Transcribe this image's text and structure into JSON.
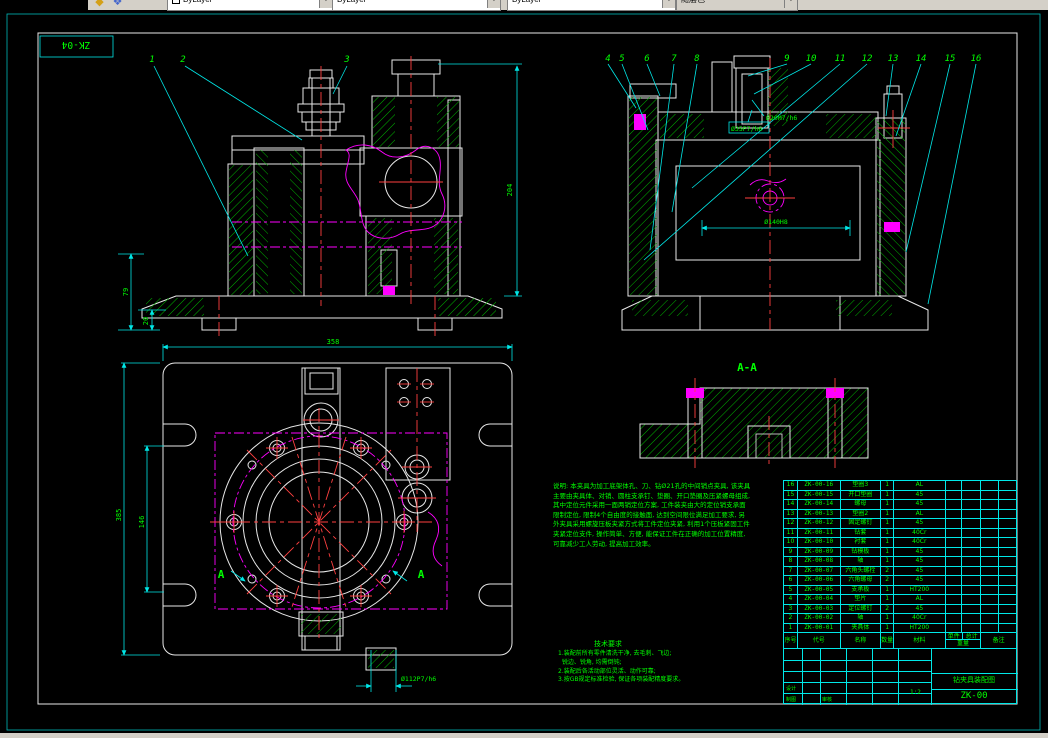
{
  "toolbar": {
    "combo_layer": "ByLayer",
    "combo_color": "ByLayer",
    "combo_linetype": "ByLayer",
    "combo_plotstyle": "随层色"
  },
  "frame": {
    "corner_label": "ZK-04"
  },
  "colors": {
    "line": "#e8e8e8",
    "dimension": "#00e8e8",
    "text": "#00ff00",
    "phantom": "#ff00ff",
    "centerline": "#ff4040",
    "background": "#000000"
  },
  "balloons": {
    "front": [
      "1",
      "2",
      "3"
    ],
    "side": [
      "4",
      "5",
      "6",
      "7",
      "8",
      "9",
      "10",
      "11",
      "12",
      "13",
      "14",
      "15",
      "16"
    ]
  },
  "dims": {
    "front_height": "204",
    "front_base": "79",
    "front_foot": "20",
    "side_fit_upper": "Ø20M7/h6",
    "side_fit_lower": "Ø35P7/h6",
    "side_bore": "Ø140H8",
    "plan_width": "358",
    "plan_total_height": "385",
    "plan_mid_height": "146",
    "plan_bore": "Ø112P7/h6"
  },
  "section": {
    "label": "A-A",
    "marker": "A"
  },
  "notes": {
    "lines": [
      "说明: 本夹具为加工底架体孔、刀、钻Ø21孔的中间销点夹具, 该夹具",
      "主要由夹具体、对销、圆柱支承钉、垫圈、开口垫圈及压紧螺母组成,",
      "其中定位元件采用一面两销定位方案, 工件装夹由大的定位销支承面",
      "限制定位, 限制4个自由度的接触面, 达到空间限位满足加工要求, 另",
      "外夹具采用螺旋压板夹紧方式将工件定位夹紧, 利用1个压板紧固工件",
      "夹紧定位支件, 操作简单、方便, 能保证工件在正确的加工位置精度,",
      "可靠减少工人劳动, 提高加工效率。"
    ]
  },
  "tech": {
    "title": "技术要求",
    "lines": [
      "1.装配前所有零件清洗干净, 去毛刺、飞边;",
      "  锐边、锐角, 均需倒钝;",
      "2.装配后各活动部位灵活、动作可靠;",
      "3.按GB规定标准检验, 保证各项装配精度要求。"
    ]
  },
  "bom": {
    "headers": {
      "seq": "序号",
      "code": "代号",
      "name": "名称",
      "qty": "数量",
      "material": "材料",
      "unit": "单件",
      "total": "总计",
      "weight": "重量",
      "remark": "备注"
    },
    "rows": [
      {
        "seq": "16",
        "code": "ZK-00-16",
        "name": "垫圈3",
        "qty": "1",
        "material": "AL"
      },
      {
        "seq": "15",
        "code": "ZK-00-15",
        "name": "开口垫圈",
        "qty": "1",
        "material": "45"
      },
      {
        "seq": "14",
        "code": "ZK-00-14",
        "name": "螺母",
        "qty": "1",
        "material": "45"
      },
      {
        "seq": "13",
        "code": "ZK-00-13",
        "name": "垫圈2",
        "qty": "1",
        "material": "AL"
      },
      {
        "seq": "12",
        "code": "ZK-00-12",
        "name": "固定螺钉",
        "qty": "1",
        "material": "45"
      },
      {
        "seq": "11",
        "code": "ZK-00-11",
        "name": "钻套",
        "qty": "1",
        "material": "40Cr"
      },
      {
        "seq": "10",
        "code": "ZK-00-10",
        "name": "衬套",
        "qty": "1",
        "material": "40Cr"
      },
      {
        "seq": "9",
        "code": "ZK-00-09",
        "name": "钻模板",
        "qty": "1",
        "material": "45"
      },
      {
        "seq": "8",
        "code": "ZK-00-08",
        "name": "轴",
        "qty": "1",
        "material": "45"
      },
      {
        "seq": "7",
        "code": "ZK-00-07",
        "name": "六角头螺栓",
        "qty": "2",
        "material": "45"
      },
      {
        "seq": "6",
        "code": "ZK-00-06",
        "name": "六角螺母",
        "qty": "2",
        "material": "45"
      },
      {
        "seq": "5",
        "code": "ZK-00-05",
        "name": "支承板",
        "qty": "1",
        "material": "HT200"
      },
      {
        "seq": "4",
        "code": "ZK-00-04",
        "name": "垫片",
        "qty": "1",
        "material": "AL"
      },
      {
        "seq": "3",
        "code": "ZK-00-03",
        "name": "定位螺钉",
        "qty": "2",
        "material": "45"
      },
      {
        "seq": "2",
        "code": "ZK-00-02",
        "name": "轴",
        "qty": "1",
        "material": "40Cr"
      },
      {
        "seq": "1",
        "code": "ZK-00-01",
        "name": "夹具体",
        "qty": "1",
        "material": "HT200"
      }
    ]
  },
  "title_block": {
    "designer_label": "设计",
    "drafter_label": "制图",
    "checker_label": "审核",
    "scale": "1:2",
    "title": "钻夹具装配图",
    "drawing_no": "ZK-00"
  }
}
